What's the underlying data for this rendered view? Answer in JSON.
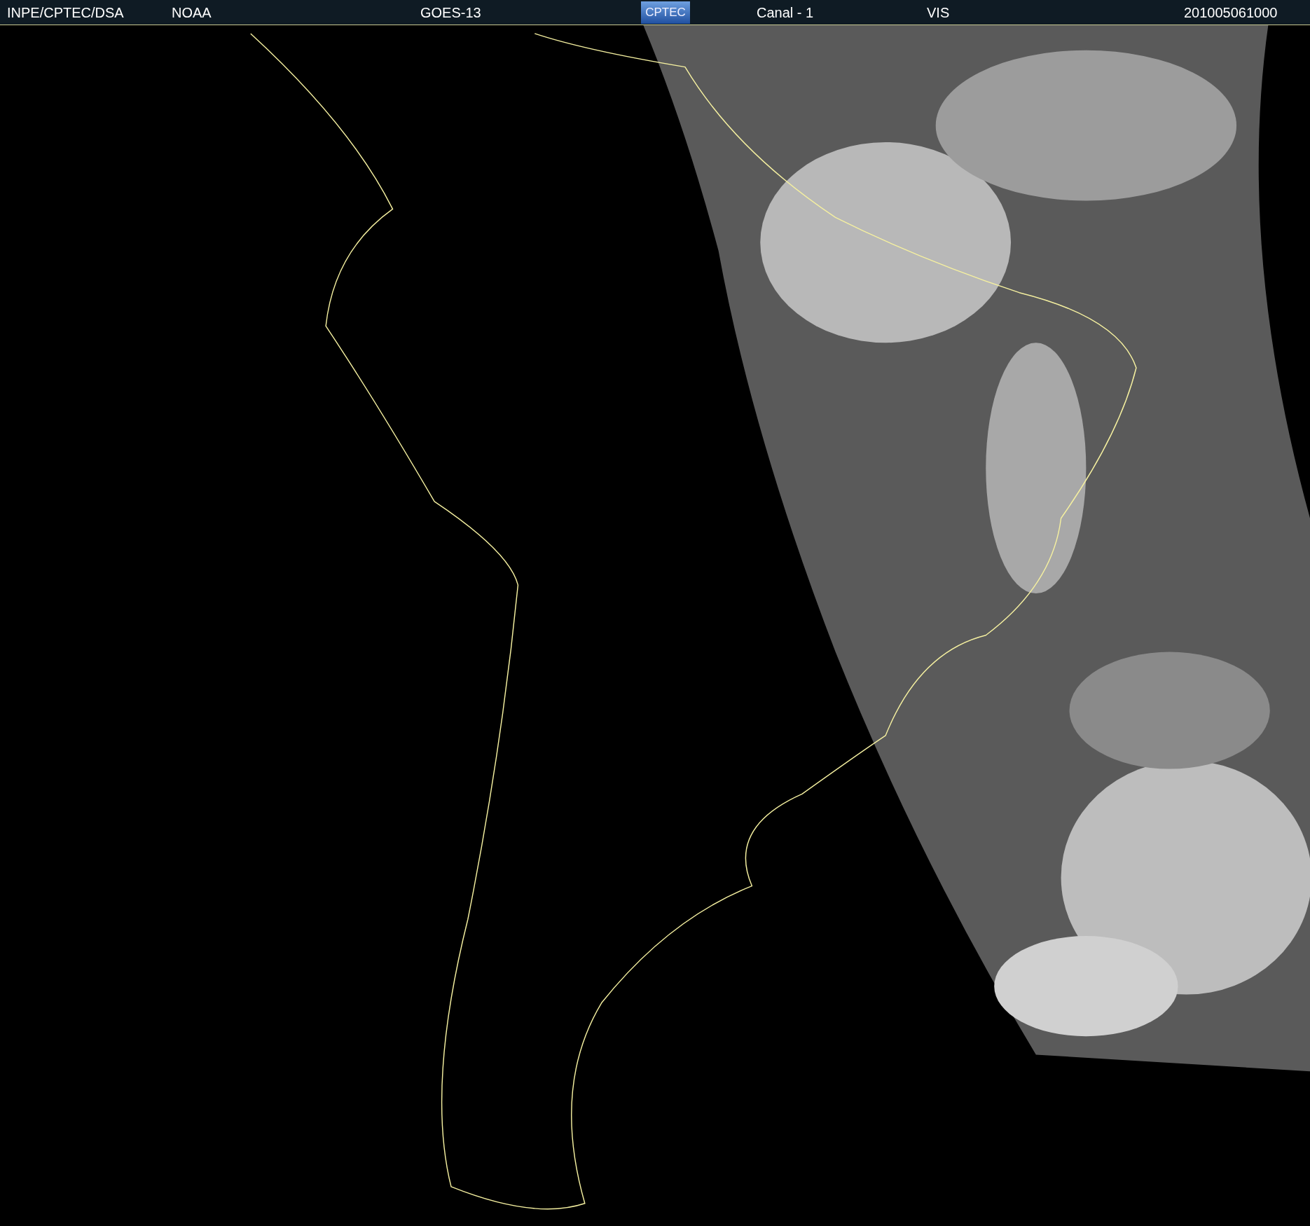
{
  "header": {
    "source": "INPE/CPTEC/DSA",
    "agency": "NOAA",
    "satellite": "GOES-13",
    "logo": "CPTEC",
    "channel": "Canal - 1",
    "band": "VIS",
    "timestamp": "201005061000"
  }
}
